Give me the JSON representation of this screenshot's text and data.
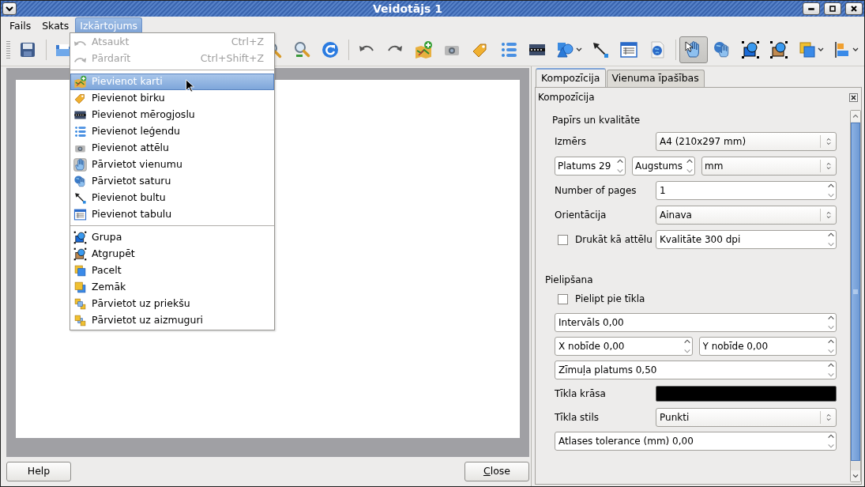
{
  "window": {
    "title": "Veidotājs 1"
  },
  "menubar": [
    {
      "label": "Fails",
      "selected": false
    },
    {
      "label": "Skats",
      "selected": false
    },
    {
      "label": "Izkārtojums",
      "selected": true
    }
  ],
  "toolbar": [
    [
      {
        "kind": "button",
        "selected": false
      }
    ],
    [
      {
        "kind": "button",
        "selected": false
      },
      {
        "kind": "button",
        "selected": false
      },
      {
        "kind": "button",
        "selected": false
      },
      {
        "kind": "button",
        "selected": false
      }
    ],
    [
      {
        "kind": "button",
        "selected": false
      },
      {
        "kind": "button",
        "selected": false
      },
      {
        "kind": "button",
        "selected": false
      },
      {
        "kind": "button",
        "selected": false
      },
      {
        "kind": "button",
        "selected": false
      },
      {
        "kind": "button",
        "selected": false
      },
      {
        "kind": "button",
        "selected": false
      },
      {
        "kind": "dropdown",
        "selected": false
      },
      {
        "kind": "button",
        "selected": false
      },
      {
        "kind": "button",
        "selected": false
      },
      {
        "kind": "button",
        "selected": false
      }
    ],
    [
      {
        "kind": "button",
        "selected": true
      },
      {
        "kind": "button",
        "selected": false
      },
      {
        "kind": "button",
        "selected": false
      },
      {
        "kind": "button",
        "selected": false
      },
      {
        "kind": "dropdown",
        "selected": false
      },
      {
        "kind": "dropdown",
        "selected": false
      }
    ]
  ],
  "open_menu": [
    {
      "kind": "item",
      "label": "Atsaukt",
      "shortcut": "Ctrl+Z",
      "disabled": true,
      "selected": false
    },
    {
      "kind": "item",
      "label": "Pārdarīt",
      "shortcut": "Ctrl+Shift+Z",
      "disabled": true,
      "selected": false
    },
    {
      "kind": "separator"
    },
    {
      "kind": "item",
      "label": "Pievienot karti",
      "disabled": false,
      "selected": true
    },
    {
      "kind": "item",
      "label": "Pievienot  birku",
      "disabled": false,
      "selected": false
    },
    {
      "kind": "item",
      "label": "Pievienot mērogjoslu",
      "disabled": false,
      "selected": false
    },
    {
      "kind": "item",
      "label": "Pievienot leģendu",
      "disabled": false,
      "selected": false
    },
    {
      "kind": "item",
      "label": "Pievienot attēlu",
      "disabled": false,
      "selected": false
    },
    {
      "kind": "item",
      "label": "Pārvietot vienumu",
      "disabled": false,
      "selected": false
    },
    {
      "kind": "item",
      "label": "Pārvietot saturu",
      "disabled": false,
      "selected": false
    },
    {
      "kind": "item",
      "label": "Pievienot bultu",
      "disabled": false,
      "selected": false
    },
    {
      "kind": "item",
      "label": "Pievienot tabulu",
      "disabled": false,
      "selected": false
    },
    {
      "kind": "separator"
    },
    {
      "kind": "item",
      "label": "Grupa",
      "disabled": false,
      "selected": false
    },
    {
      "kind": "item",
      "label": "Atgrupēt",
      "disabled": false,
      "selected": false
    },
    {
      "kind": "item",
      "label": "Pacelt",
      "disabled": false,
      "selected": false
    },
    {
      "kind": "item",
      "label": "Zemāk",
      "disabled": false,
      "selected": false
    },
    {
      "kind": "item",
      "label": "Pārvietot uz priekšu",
      "disabled": false,
      "selected": false
    },
    {
      "kind": "item",
      "label": "Pārvietot uz aizmuguri",
      "disabled": false,
      "selected": false
    }
  ],
  "panel": {
    "tabs": [
      {
        "label": "Kompozīcija",
        "selected": true
      },
      {
        "label": "Vienuma īpašības",
        "selected": false
      }
    ],
    "title": "Kompozīcija",
    "sections": [
      {
        "title": "Papīrs un kvalitāte",
        "rows": [
          [
            {
              "kind": "label",
              "text": "Izmērs"
            },
            {
              "kind": "select",
              "value": "A4 (210x297 mm)"
            }
          ],
          [
            {
              "kind": "spin",
              "value": "Platums 29"
            },
            {
              "kind": "spin",
              "value": "Augstums"
            },
            {
              "kind": "select",
              "value": "mm"
            }
          ],
          [
            {
              "kind": "label",
              "text": "Number of pages"
            },
            {
              "kind": "spin",
              "value": "1"
            }
          ],
          [
            {
              "kind": "label",
              "text": "Orientācija"
            },
            {
              "kind": "select",
              "value": "Ainava"
            }
          ],
          [
            {
              "kind": "checkbox",
              "label": "Drukāt kā attēlu",
              "checked": false
            },
            {
              "kind": "spin",
              "value": "Kvalitāte 300 dpi"
            }
          ]
        ]
      },
      {
        "title": "Pielipšana",
        "rows": [
          [
            {
              "kind": "checkbox",
              "label": "Pielipt pie tīkla",
              "checked": false
            }
          ],
          [
            {
              "kind": "spin",
              "value": "Intervāls 0,00"
            }
          ],
          [
            {
              "kind": "spin",
              "value": "X nobīde 0,00"
            },
            {
              "kind": "spin",
              "value": "Y nobīde 0,00"
            }
          ],
          [
            {
              "kind": "spin",
              "value": "Zīmuļa platums 0,50"
            }
          ],
          [
            {
              "kind": "label",
              "text": "Tīkla krāsa"
            },
            {
              "kind": "color",
              "color": "#000000"
            }
          ],
          [
            {
              "kind": "label",
              "text": "Tīkla stils"
            },
            {
              "kind": "select",
              "value": "Punkti"
            }
          ],
          [
            {
              "kind": "spin",
              "value": "Atlases tolerance (mm) 0,00"
            }
          ]
        ]
      }
    ]
  },
  "buttons": [
    {
      "label": "Help",
      "mnemonic": false
    },
    {
      "label": "Close",
      "mnemonic": true
    }
  ]
}
